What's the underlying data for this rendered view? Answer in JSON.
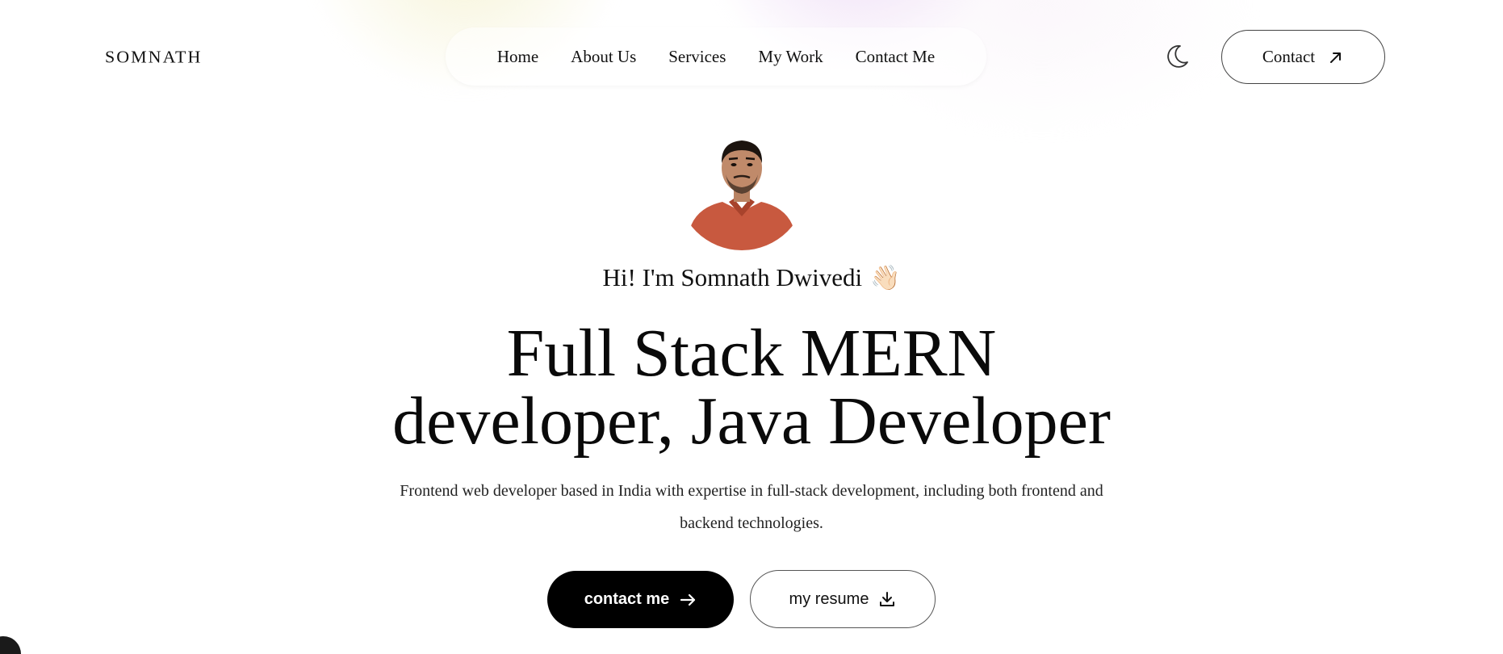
{
  "brand": {
    "logo_text": "SOMNATH"
  },
  "nav": {
    "items": [
      {
        "label": "Home"
      },
      {
        "label": "About Us"
      },
      {
        "label": "Services"
      },
      {
        "label": "My Work"
      },
      {
        "label": "Contact Me"
      }
    ]
  },
  "header": {
    "theme_toggle_icon": "moon-icon",
    "contact_label": "Contact",
    "contact_icon": "arrow-up-right-icon"
  },
  "hero": {
    "avatar_icon": "profile-photo",
    "greeting": "Hi! I'm Somnath Dwivedi",
    "greeting_emoji": "👋🏻",
    "headline_line1": "Full Stack MERN",
    "headline_line2": "developer, Java Developer",
    "description": "Frontend web developer based in India with expertise in full-stack development, including both frontend and backend technologies.",
    "primary_button_label": "contact me",
    "primary_button_icon": "arrow-right-icon",
    "secondary_button_label": "my resume",
    "secondary_button_icon": "download-icon"
  },
  "colors": {
    "primary_button_bg": "#000000",
    "primary_button_text": "#ffffff",
    "text": "#111111",
    "shirt": "#c8593f"
  }
}
